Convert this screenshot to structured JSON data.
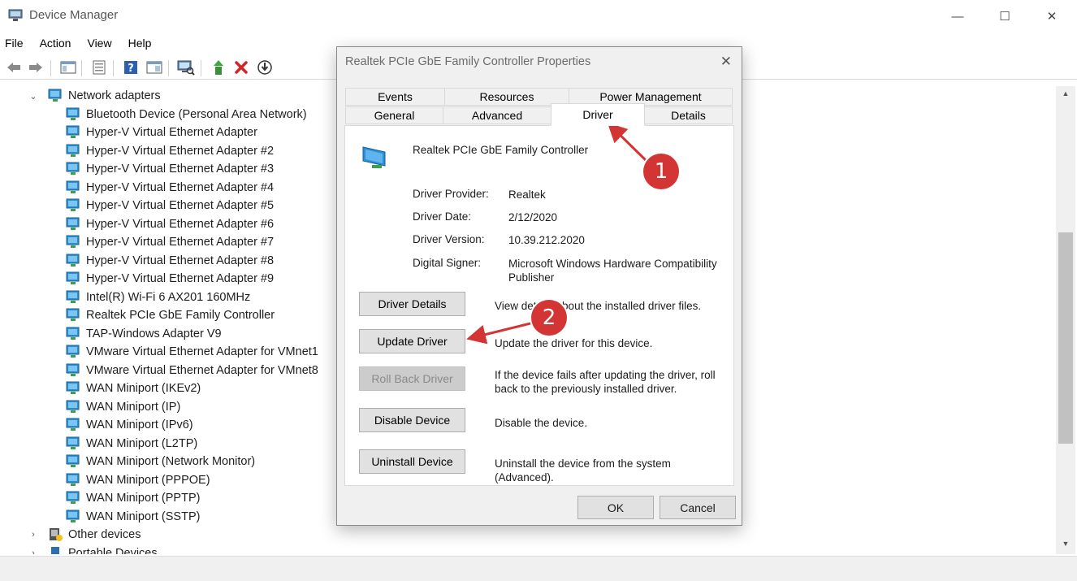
{
  "window": {
    "title": "Device Manager",
    "controls": {
      "minimize": "—",
      "maximize": "☐",
      "close": "✕"
    }
  },
  "menu": [
    "File",
    "Action",
    "View",
    "Help"
  ],
  "toolbar": [
    "back-icon",
    "forward-icon",
    "show-hide-tree-icon",
    "properties-icon",
    "help-icon",
    "view-icon",
    "scan-hardware-icon",
    "update-driver-icon",
    "uninstall-icon",
    "disable-icon"
  ],
  "tree": {
    "category": {
      "label": "Network adapters",
      "expanded": true
    },
    "items": [
      "Bluetooth Device (Personal Area Network)",
      "Hyper-V Virtual Ethernet Adapter",
      "Hyper-V Virtual Ethernet Adapter #2",
      "Hyper-V Virtual Ethernet Adapter #3",
      "Hyper-V Virtual Ethernet Adapter #4",
      "Hyper-V Virtual Ethernet Adapter #5",
      "Hyper-V Virtual Ethernet Adapter #6",
      "Hyper-V Virtual Ethernet Adapter #7",
      "Hyper-V Virtual Ethernet Adapter #8",
      "Hyper-V Virtual Ethernet Adapter #9",
      "Intel(R) Wi-Fi 6 AX201 160MHz",
      "Realtek PCIe GbE Family Controller",
      "TAP-Windows Adapter V9",
      "VMware Virtual Ethernet Adapter for VMnet1",
      "VMware Virtual Ethernet Adapter for VMnet8",
      "WAN Miniport (IKEv2)",
      "WAN Miniport (IP)",
      "WAN Miniport (IPv6)",
      "WAN Miniport (L2TP)",
      "WAN Miniport (Network Monitor)",
      "WAN Miniport (PPPOE)",
      "WAN Miniport (PPTP)",
      "WAN Miniport (SSTP)"
    ],
    "other_categories": [
      "Other devices",
      "Portable Devices"
    ]
  },
  "dialog": {
    "title": "Realtek PCIe GbE Family Controller Properties",
    "tabs_row1": [
      "Events",
      "Resources",
      "Power Management"
    ],
    "tabs_row2": [
      "General",
      "Advanced",
      "Driver",
      "Details"
    ],
    "active_tab": "Driver",
    "device_name": "Realtek PCIe GbE Family Controller",
    "properties": [
      {
        "label": "Driver Provider:",
        "value": "Realtek"
      },
      {
        "label": "Driver Date:",
        "value": "2/12/2020"
      },
      {
        "label": "Driver Version:",
        "value": "10.39.212.2020"
      },
      {
        "label": "Digital Signer:",
        "value": "Microsoft Windows Hardware Compatibility Publisher"
      }
    ],
    "actions": [
      {
        "label": "Driver Details",
        "desc": "View details about the installed driver files.",
        "enabled": true
      },
      {
        "label": "Update Driver",
        "desc": "Update the driver for this device.",
        "enabled": true
      },
      {
        "label": "Roll Back Driver",
        "desc": "If the device fails after updating the driver, roll back to the previously installed driver.",
        "enabled": false
      },
      {
        "label": "Disable Device",
        "desc": "Disable the device.",
        "enabled": true
      },
      {
        "label": "Uninstall Device",
        "desc": "Uninstall the device from the system (Advanced).",
        "enabled": true
      }
    ],
    "ok_label": "OK",
    "cancel_label": "Cancel"
  },
  "callouts": [
    "1",
    "2"
  ],
  "colors": {
    "accent": "#d33434",
    "network_icon": "#2b8fd6"
  }
}
